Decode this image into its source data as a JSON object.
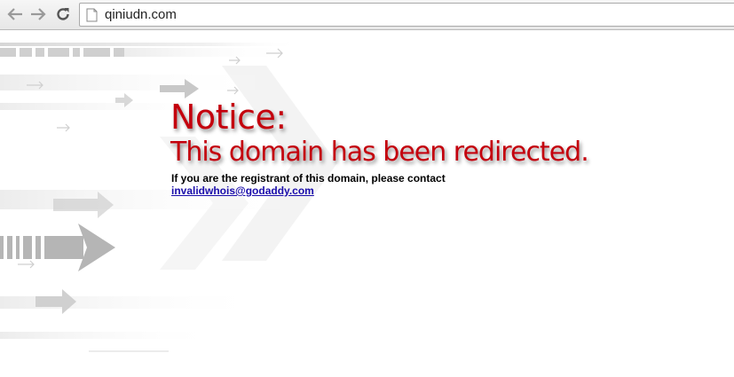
{
  "browser": {
    "url": "qiniudn.com",
    "icons": {
      "back": "back-arrow-icon",
      "forward": "forward-arrow-icon",
      "reload": "reload-icon",
      "page": "page-icon"
    }
  },
  "page": {
    "title": "Notice:",
    "subtitle": "This domain has been redirected.",
    "contact_text": "If you are the registrant of this domain, please contact",
    "contact_email": "invalidwhois@godaddy.com",
    "colors": {
      "heading": "#c4000d",
      "link": "#1a0dab"
    }
  }
}
